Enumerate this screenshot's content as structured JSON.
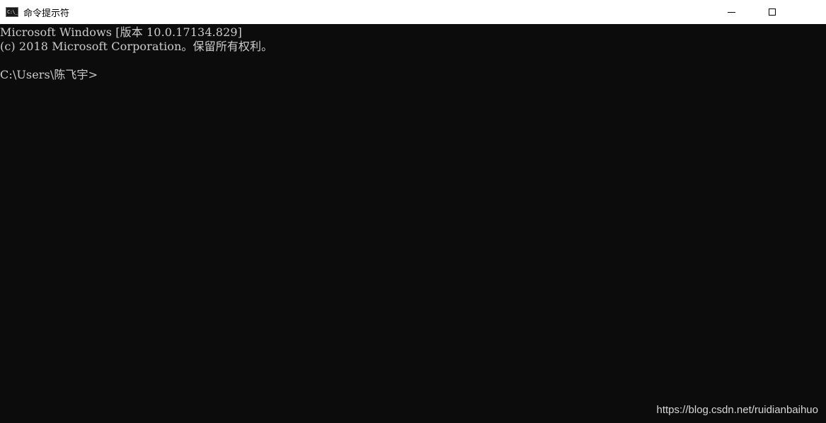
{
  "window": {
    "title": "命令提示符",
    "icon": "cmd-icon",
    "icon_glyph": "C:\\_"
  },
  "controls": {
    "minimize": "minimize-icon",
    "maximize": "maximize-icon"
  },
  "console": {
    "lines": [
      "Microsoft Windows [版本 10.0.17134.829]",
      "(c) 2018 Microsoft Corporation。保留所有权利。",
      "",
      "C:\\Users\\陈飞宇>"
    ]
  },
  "watermark": "https://blog.csdn.net/ruidianbaihuo",
  "colors": {
    "console_bg": "#0c0c0c",
    "console_text": "#cccccc",
    "titlebar_bg": "#ffffff"
  }
}
